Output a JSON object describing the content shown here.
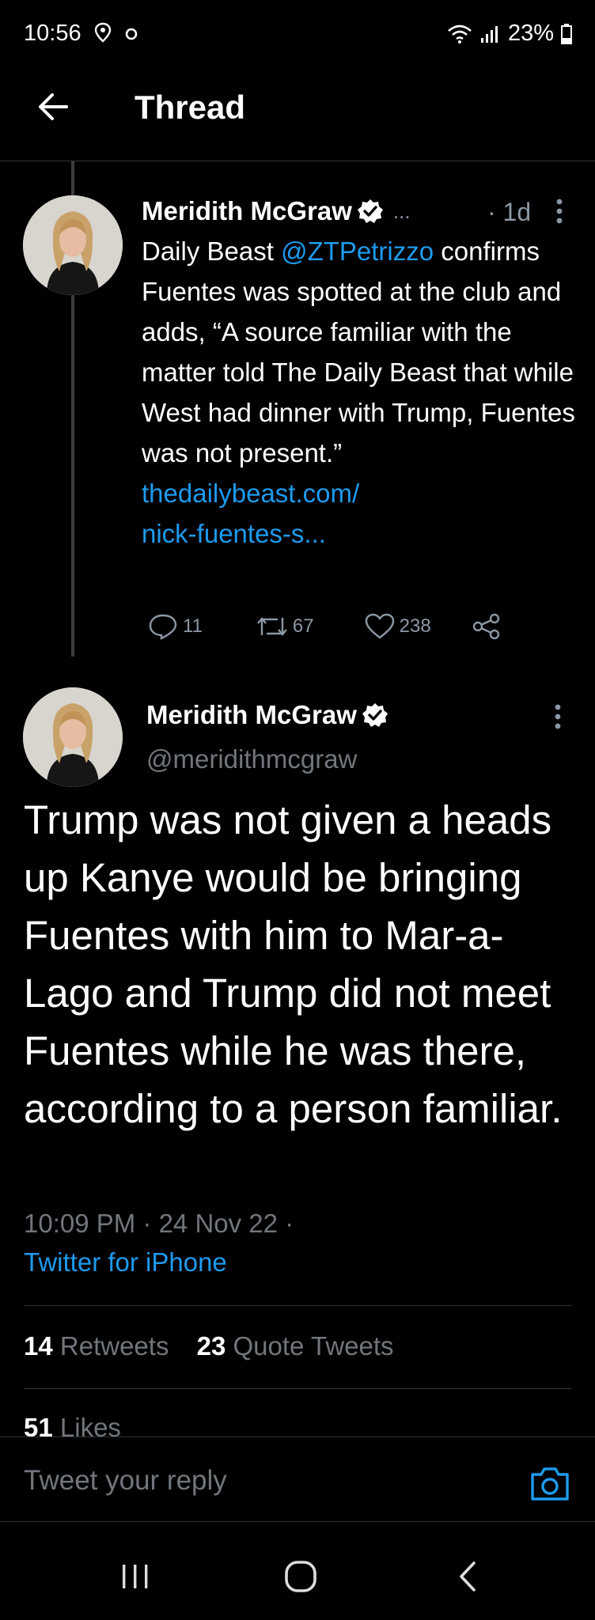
{
  "status_bar": {
    "time": "10:56",
    "battery": "23%"
  },
  "header": {
    "title": "Thread"
  },
  "tweet1": {
    "name": "Meridith McGraw",
    "ellipsis": "...",
    "age": "· 1d",
    "text_prefix": "Daily Beast ",
    "mention": "@ZTPetrizzo",
    "text_body": " confirms Fuentes was spotted at the club and adds, “A source familiar with the matter told The Daily Beast that while West had dinner with Trump, Fuentes was not present.”",
    "link_line1": "thedailybeast.com/",
    "link_line2": "nick-fuentes-s...",
    "replies": "11",
    "retweets": "67",
    "likes": "238"
  },
  "tweet2": {
    "name": "Meridith McGraw",
    "handle": "@meridithmcgraw",
    "text": "Trump was not given a heads up Kanye would be bringing Fuentes with him to Mar-a-Lago and Trump did not meet Fuentes while he was there, according to a person familiar.",
    "timestamp": "10:09 PM · 24 Nov 22 ·",
    "source": "Twitter for iPhone",
    "retweets_count": "14",
    "retweets_label": "Retweets",
    "quotes_count": "23",
    "quotes_label": "Quote Tweets",
    "likes_count": "51",
    "likes_label": "Likes"
  },
  "reply": {
    "placeholder": "Tweet your reply"
  },
  "colors": {
    "accent": "#1d9bf0",
    "background": "#000000",
    "muted": "#71767b"
  },
  "icons": [
    "location-icon",
    "record-icon",
    "wifi-icon",
    "signal-icon",
    "battery-icon",
    "back-arrow-icon",
    "verified-icon",
    "more-icon",
    "reply-icon",
    "retweet-icon",
    "like-icon",
    "share-icon",
    "camera-icon",
    "recents-icon",
    "home-icon",
    "nav-back-icon"
  ]
}
